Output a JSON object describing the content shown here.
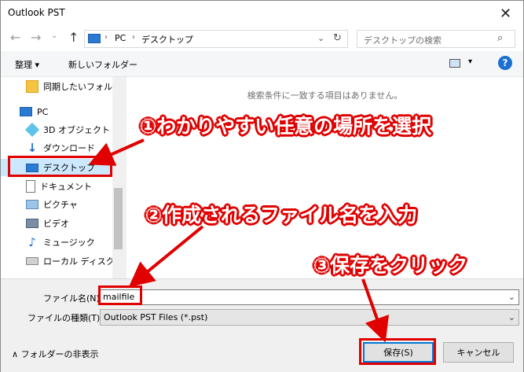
{
  "window": {
    "title": "Outlook PST"
  },
  "nav": {
    "address": [
      "PC",
      "デスクトップ"
    ],
    "search_placeholder": "デスクトップの検索"
  },
  "toolbar": {
    "organize": "整理 ▾",
    "new_folder": "新しいフォルダー"
  },
  "sidebar": {
    "items": [
      {
        "label": "同期したいフォルダ",
        "icon": "folder-icon"
      },
      {
        "label": "PC",
        "icon": "pc-icon"
      },
      {
        "label": "3D オブジェクト",
        "icon": "3d-objects-icon"
      },
      {
        "label": "ダウンロード",
        "icon": "download-icon"
      },
      {
        "label": "デスクトップ",
        "icon": "desktop-icon",
        "selected": true
      },
      {
        "label": "ドキュメント",
        "icon": "document-icon"
      },
      {
        "label": "ピクチャ",
        "icon": "pictures-icon"
      },
      {
        "label": "ビデオ",
        "icon": "video-icon"
      },
      {
        "label": "ミュージック",
        "icon": "music-icon"
      },
      {
        "label": "ローカル ディスク (C",
        "icon": "disk-icon"
      }
    ]
  },
  "content": {
    "empty_message": "検索条件に一致する項目はありません。"
  },
  "form": {
    "filename_label": "ファイル名(N):",
    "filename_value": "mailfile",
    "filetype_label": "ファイルの種類(T):",
    "filetype_value": "Outlook PST Files (*.pst)",
    "hide_folders": "フォルダーの非表示",
    "save": "保存(S)",
    "cancel": "キャンセル"
  },
  "annotations": {
    "step1": "①わかりやすい任意の場所を選択",
    "step2": "②作成されるファイル名を入力",
    "step3": "③保存をクリック"
  },
  "colors": {
    "annotation_red": "#e00000",
    "accent_blue": "#0078d7",
    "help_blue": "#1a6fd0"
  }
}
